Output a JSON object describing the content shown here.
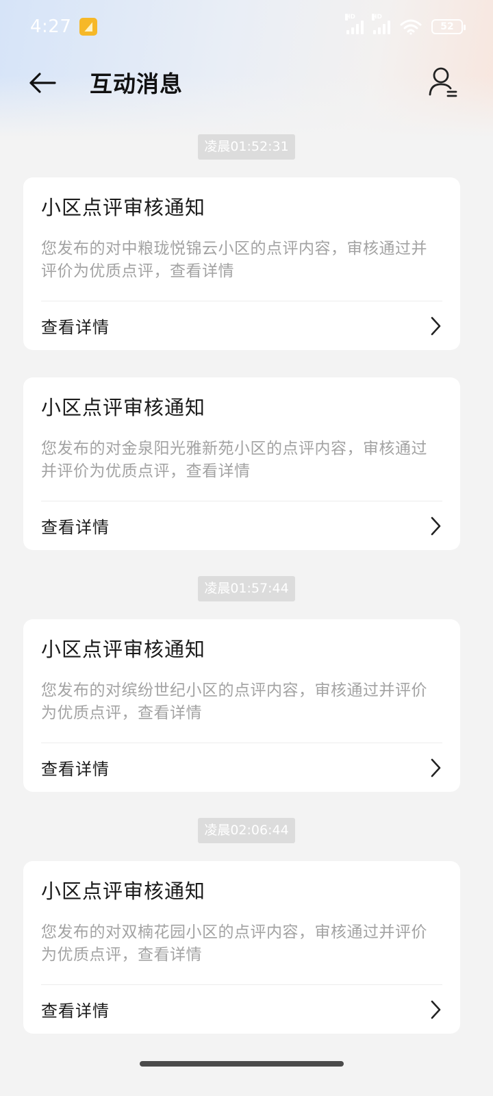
{
  "status_bar": {
    "time": "4:27",
    "battery": "52",
    "network_1": "HD",
    "network_2": "HD"
  },
  "header": {
    "title": "互动消息"
  },
  "feed": [
    {
      "timestamp": "凌晨01:52:31",
      "cards": [
        {
          "title": "小区点评审核通知",
          "body": "您发布的对中粮珑悦锦云小区的点评内容，审核通过并评价为优质点评，查看详情",
          "link": "查看详情"
        },
        {
          "title": "小区点评审核通知",
          "body": "您发布的对金泉阳光雅新苑小区的点评内容，审核通过并评价为优质点评，查看详情",
          "link": "查看详情"
        }
      ]
    },
    {
      "timestamp": "凌晨01:57:44",
      "cards": [
        {
          "title": "小区点评审核通知",
          "body": "您发布的对缤纷世纪小区的点评内容，审核通过并评价为优质点评，查看详情",
          "link": "查看详情"
        }
      ]
    },
    {
      "timestamp": "凌晨02:06:44",
      "cards": [
        {
          "title": "小区点评审核通知",
          "body": "您发布的对双楠花园小区的点评内容，审核通过并评价为优质点评，查看详情",
          "link": "查看详情"
        }
      ]
    }
  ],
  "colors": {
    "background": "#f3f3f3",
    "card": "#ffffff",
    "timestamp_bg": "#dcdcdc",
    "body_text": "#a3a3a3",
    "title_text": "#1a1a1a"
  }
}
